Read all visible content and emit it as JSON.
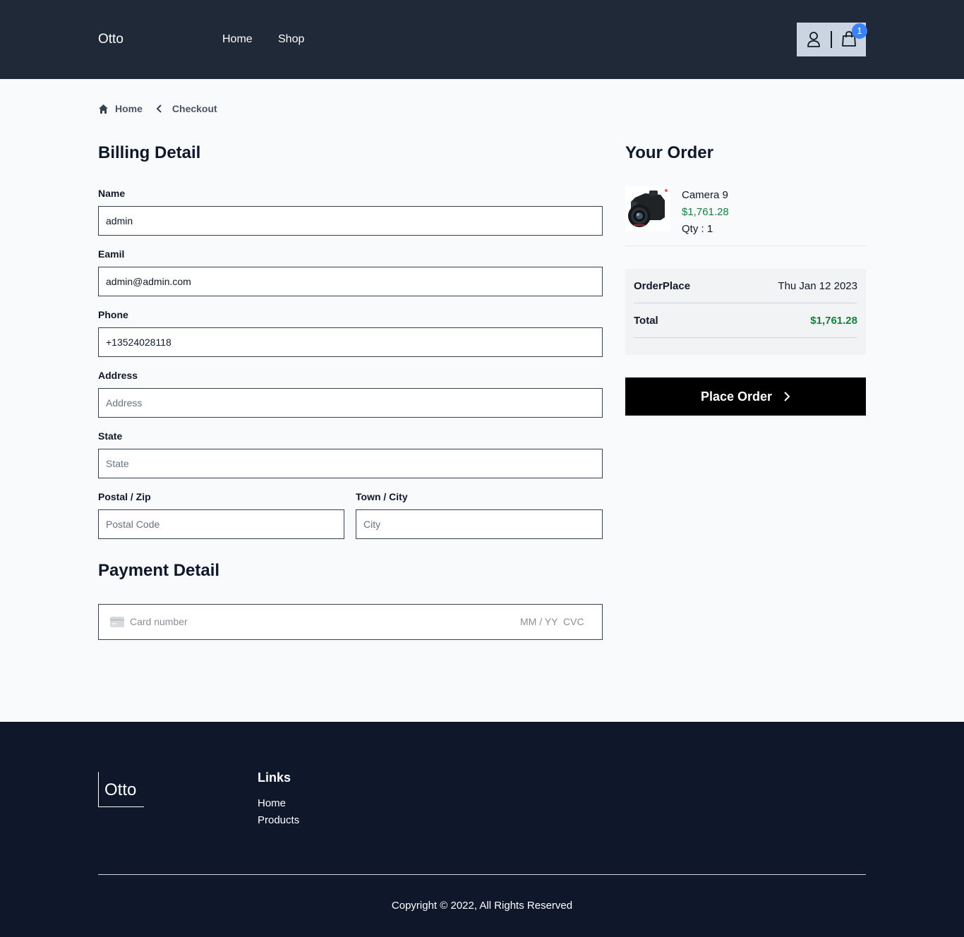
{
  "header": {
    "logo": "Otto",
    "nav": {
      "home": "Home",
      "shop": "Shop"
    },
    "cart_count": "1"
  },
  "breadcrumb": {
    "home": "Home",
    "current": "Checkout"
  },
  "billing": {
    "title": "Billing Detail",
    "name": {
      "label": "Name",
      "value": "admin"
    },
    "email": {
      "label": "Eamil",
      "value": "admin@admin.com"
    },
    "phone": {
      "label": "Phone",
      "value": "+13524028118"
    },
    "address": {
      "label": "Address",
      "placeholder": "Address",
      "value": ""
    },
    "state": {
      "label": "State",
      "placeholder": "State",
      "value": ""
    },
    "postal": {
      "label": "Postal / Zip",
      "placeholder": "Postal Code",
      "value": ""
    },
    "city": {
      "label": "Town / City",
      "placeholder": "City",
      "value": ""
    }
  },
  "payment": {
    "title": "Payment Detail",
    "card_number_placeholder": "Card number",
    "expiry_placeholder": "MM / YY",
    "cvc_placeholder": "CVC"
  },
  "order": {
    "title": "Your Order",
    "item": {
      "name": "Camera 9",
      "price": "$1,761.28",
      "qty": "Qty : 1"
    },
    "order_place_label": "OrderPlace",
    "order_place_value": "Thu Jan 12 2023",
    "total_label": "Total",
    "total_value": "$1,761.28",
    "place_order_label": "Place Order"
  },
  "footer": {
    "logo": "Otto",
    "links_title": "Links",
    "links": [
      "Home",
      "Products"
    ],
    "copyright": "Copyright © 2022, All Rights Reserved"
  },
  "colors": {
    "header_bg": "#1f2937",
    "footer_bg": "#0f172a",
    "price_green": "#15803d",
    "badge_blue": "#3b82f6",
    "button_bg": "#000000"
  }
}
